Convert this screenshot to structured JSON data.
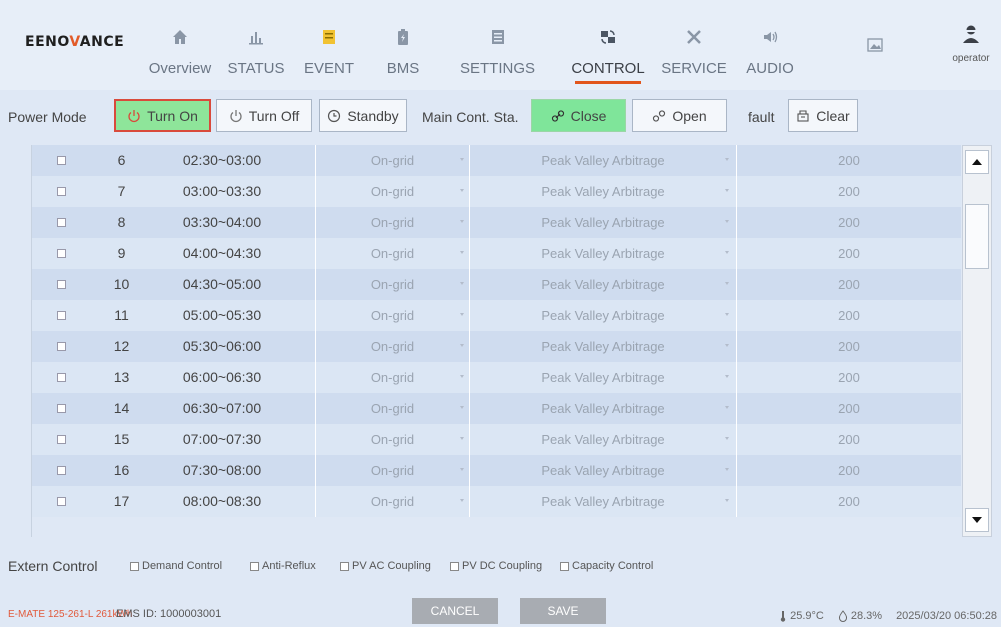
{
  "logo": {
    "prefix": "EENO",
    "accent": "V",
    "suffix": "ANCE"
  },
  "nav": [
    {
      "label": "Overview",
      "icon": "home-icon"
    },
    {
      "label": "STATUS",
      "icon": "chart-icon"
    },
    {
      "label": "EVENT",
      "icon": "event-icon"
    },
    {
      "label": "BMS",
      "icon": "battery-icon"
    },
    {
      "label": "SETTINGS",
      "icon": "settings-icon"
    },
    {
      "label": "CONTROL",
      "icon": "control-icon",
      "active": true
    },
    {
      "label": "SERVICE",
      "icon": "service-icon"
    },
    {
      "label": "AUDIO",
      "icon": "audio-icon"
    },
    {
      "label": "",
      "icon": "image-icon"
    }
  ],
  "user": {
    "label": "operator"
  },
  "toolbar": {
    "power_mode_label": "Power Mode",
    "turn_on": "Turn On",
    "turn_off": "Turn Off",
    "standby": "Standby",
    "main_cont_label": "Main Cont. Sta.",
    "close": "Close",
    "open": "Open",
    "fault_label": "fault",
    "clear": "Clear"
  },
  "rows": [
    {
      "num": "6",
      "time": "02:30~03:00",
      "mode": "On-grid",
      "strategy": "Peak Valley Arbitrage",
      "power": "200"
    },
    {
      "num": "7",
      "time": "03:00~03:30",
      "mode": "On-grid",
      "strategy": "Peak Valley Arbitrage",
      "power": "200"
    },
    {
      "num": "8",
      "time": "03:30~04:00",
      "mode": "On-grid",
      "strategy": "Peak Valley Arbitrage",
      "power": "200"
    },
    {
      "num": "9",
      "time": "04:00~04:30",
      "mode": "On-grid",
      "strategy": "Peak Valley Arbitrage",
      "power": "200"
    },
    {
      "num": "10",
      "time": "04:30~05:00",
      "mode": "On-grid",
      "strategy": "Peak Valley Arbitrage",
      "power": "200"
    },
    {
      "num": "11",
      "time": "05:00~05:30",
      "mode": "On-grid",
      "strategy": "Peak Valley Arbitrage",
      "power": "200"
    },
    {
      "num": "12",
      "time": "05:30~06:00",
      "mode": "On-grid",
      "strategy": "Peak Valley Arbitrage",
      "power": "200"
    },
    {
      "num": "13",
      "time": "06:00~06:30",
      "mode": "On-grid",
      "strategy": "Peak Valley Arbitrage",
      "power": "200"
    },
    {
      "num": "14",
      "time": "06:30~07:00",
      "mode": "On-grid",
      "strategy": "Peak Valley Arbitrage",
      "power": "200"
    },
    {
      "num": "15",
      "time": "07:00~07:30",
      "mode": "On-grid",
      "strategy": "Peak Valley Arbitrage",
      "power": "200"
    },
    {
      "num": "16",
      "time": "07:30~08:00",
      "mode": "On-grid",
      "strategy": "Peak Valley Arbitrage",
      "power": "200"
    },
    {
      "num": "17",
      "time": "08:00~08:30",
      "mode": "On-grid",
      "strategy": "Peak Valley Arbitrage",
      "power": "200"
    }
  ],
  "extern": {
    "label": "Extern Control",
    "options": [
      "Demand Control",
      "Anti-Reflux",
      "PV AC Coupling",
      "PV DC Coupling",
      "Capacity Control"
    ]
  },
  "footer": {
    "device": "E-MATE 125-261-L 261kWh",
    "ems_id": "EMS ID: 1000003001",
    "cancel": "CANCEL",
    "save": "SAVE",
    "temperature": "25.9°C",
    "humidity": "28.3%",
    "datetime": "2025/03/20 06:50:28"
  },
  "colors": {
    "accent": "#e2561c",
    "button_green": "#7fe59a",
    "active_border": "#d94a3b"
  }
}
